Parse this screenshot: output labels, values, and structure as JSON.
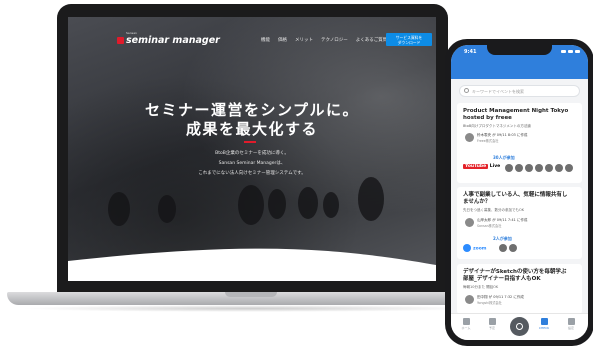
{
  "laptop": {
    "logo_brand": "seminar manager",
    "logo_sub": "Sansan",
    "nav": [
      "機能",
      "価格",
      "メリット",
      "テクノロジー",
      "よくあるご質問"
    ],
    "cta_line1": "サービス資料を",
    "cta_line2": "ダウンロード",
    "hero_title_1": "セミナー運営をシンプルに。",
    "hero_title_2": "成果を最大化する",
    "hero_body_1": "BtoB企業のセミナーを成功に導く。",
    "hero_body_2": "Sansan Seminar Managerは、",
    "hero_body_3": "これまでにない法人向けセミナー管理システムです。"
  },
  "phone": {
    "time": "9:41",
    "search_placeholder": "キーワードでイベントを検索",
    "events": [
      {
        "title_1": "Product Management Night Tokyo",
        "title_2": "hosted by freee",
        "subtitle": "BtoB向けプロダクトマネジメントの方法論",
        "author": "鈴木零央 が 09/11 8:03 に作成",
        "company": "Freee株式会社",
        "platform": "Live",
        "participants": "30人が参加"
      },
      {
        "title_1": "人事で副業している人、気軽に情報共有し",
        "title_2": "ませんか？",
        "subtitle": "先日をつ追く募集、数分の参加でもOK",
        "author": "山岸太郎 が 09/11 7:41 に作成",
        "company": "Sansan株式会社",
        "platform": "zoom",
        "participants": "2人が参加"
      },
      {
        "title_1": "デザイナーがSketchの使い方を毎朝学ぶ",
        "title_2": "部屋_デザイナー目指す人もOK",
        "subtitle": "毎朝10分また 開話OK",
        "author": "田中翔 が 09/11 7:32 に作成",
        "company": "Yongshi株式会社"
      }
    ],
    "tabs": [
      "ホーム",
      "予定",
      "",
      "CHECK",
      "設定"
    ],
    "youtube_label": "YouTube"
  }
}
